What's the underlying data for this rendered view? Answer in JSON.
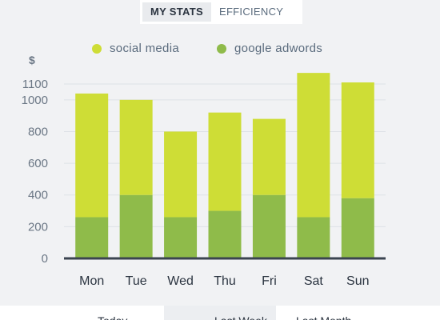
{
  "tabs": [
    {
      "label": "MY STATS",
      "active": true
    },
    {
      "label": "EFFICIENCY",
      "active": false
    }
  ],
  "bottom_tabs": [
    {
      "label": "Today",
      "active": false
    },
    {
      "label": "Last Week",
      "active": true
    },
    {
      "label": "Last Month",
      "active": false
    }
  ],
  "colors": {
    "social_media": "#cedd36",
    "google_adwords": "#8fbb4a",
    "baseline": "#3b4450",
    "grid": "#dde1e6"
  },
  "chart_data": {
    "type": "bar",
    "stacked": true,
    "title": "",
    "xlabel": "",
    "ylabel": "$",
    "categories": [
      "Mon",
      "Tue",
      "Wed",
      "Thu",
      "Fri",
      "Sat",
      "Sun"
    ],
    "series": [
      {
        "name": "google adwords",
        "values": [
          260,
          400,
          260,
          300,
          400,
          260,
          380
        ]
      },
      {
        "name": "social media",
        "values": [
          780,
          600,
          540,
          620,
          480,
          910,
          730
        ]
      }
    ],
    "yticks": [
      "0",
      "200",
      "400",
      "600",
      "800",
      "1000",
      "1100"
    ],
    "ylim": [
      0,
      1100
    ],
    "grid": true,
    "legend_position": "top"
  }
}
